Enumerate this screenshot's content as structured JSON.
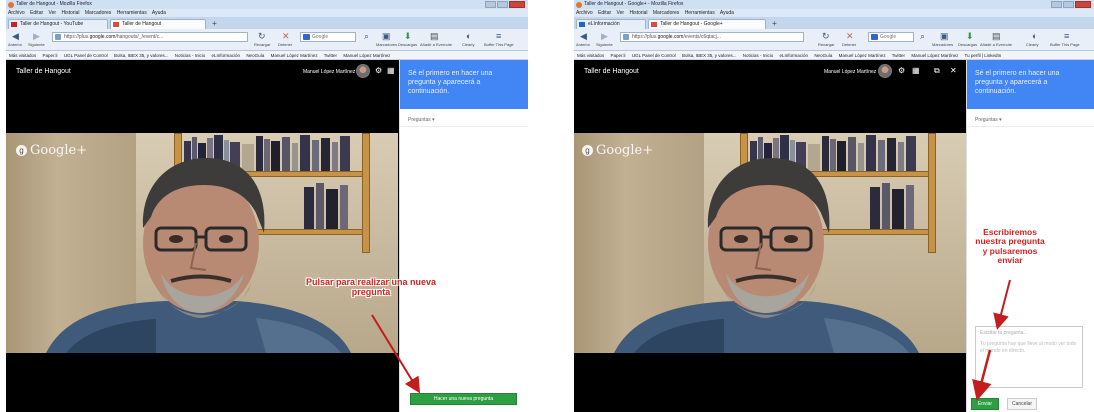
{
  "left": {
    "window_title": "Taller de Hangout - Mozilla Firefox",
    "menu": [
      "Archivo",
      "Editar",
      "Ver",
      "Historial",
      "Marcadores",
      "Herramientas",
      "Ayuda"
    ],
    "tabs": [
      {
        "label": "Taller de Hangout - YouTube",
        "color": "#cc2222"
      },
      {
        "label": "Taller de Hangout",
        "color": "#dd4b39"
      }
    ],
    "url_prefix": "https://plus.",
    "url_domain": "google.com",
    "url_rest": "/hangouts/_/event/c...",
    "search_placeholder": "Google",
    "nav": {
      "back": "Anterior",
      "forward": "Siguiente",
      "reload": "Recargar",
      "stop": "Detener",
      "bookmarks": "Marcadores",
      "downloads": "Descargas",
      "evernote": "Añadir a Evernote",
      "clearly": "Clearly",
      "buffer": "Buffer This Page"
    },
    "bookmarks": [
      "Más visitados",
      "Paper.li",
      "UGL Panel de Control",
      "Bolsa, IBEX 35, y valores...",
      "Noticias - Inicio",
      "eLInformación",
      "NeoGuía",
      "Manuel López Martínez",
      "Twitter",
      "Manuel López Martínez"
    ],
    "app_title": "Taller de Hangout",
    "user_name": "Manuel López Martínez",
    "promo_text": "Sé el primero en hacer una pregunta y aparecerá a continuación.",
    "questions_label": "Preguntas ▾",
    "brand": "Google+",
    "annotation": "Pulsar para realizar una nueva pregunta",
    "ask_button": "Hacer una nueva pregunta"
  },
  "right": {
    "window_title": "Taller de Hangout - Google+ - Mozilla Firefox",
    "menu": [
      "Archivo",
      "Editar",
      "Ver",
      "Historial",
      "Marcadores",
      "Herramientas",
      "Ayuda"
    ],
    "tabs": [
      {
        "label": "eLInformación",
        "color": "#1c67c1"
      },
      {
        "label": "Taller de Hangout - Google+",
        "color": "#dd4b39"
      }
    ],
    "url_prefix": "https://plus.",
    "url_domain": "google.com",
    "url_rest": "/events/c6qtacj...",
    "search_placeholder": "Google",
    "nav": {
      "back": "Anterior",
      "forward": "Siguiente",
      "reload": "Recargar",
      "stop": "Detener",
      "bookmarks": "Marcadores",
      "downloads": "Descargas",
      "evernote": "Añadir a Evernote",
      "clearly": "Clearly",
      "buffer": "Buffer This Page"
    },
    "bookmarks": [
      "Más visitados",
      "Paper.li",
      "UGL Panel de Control",
      "Bolsa, IBEX 35, y valores...",
      "Noticias - Inicio",
      "eLInformación",
      "NeoGuía",
      "Manuel López Martínez",
      "Twitter",
      "Manuel López Martínez",
      "Tu perfil | LinkedIn"
    ],
    "app_title": "Taller de Hangout",
    "user_name": "Manuel López Martínez",
    "promo_text": "Sé el primero en hacer una pregunta y aparecerá a continuación.",
    "questions_label": "Preguntas ▾",
    "brand": "Google+",
    "annotation_lines": [
      "Escribiremos",
      "nuestra pregunta",
      "y pulsaremos",
      "enviar"
    ],
    "question_placeholder": "Escribe tu pregunta...",
    "question_hint": "Tu pregunta hay que lleve al modo ver todo el mundo en directo.",
    "send_button": "Enviar",
    "cancel_button": "Cancelar"
  }
}
